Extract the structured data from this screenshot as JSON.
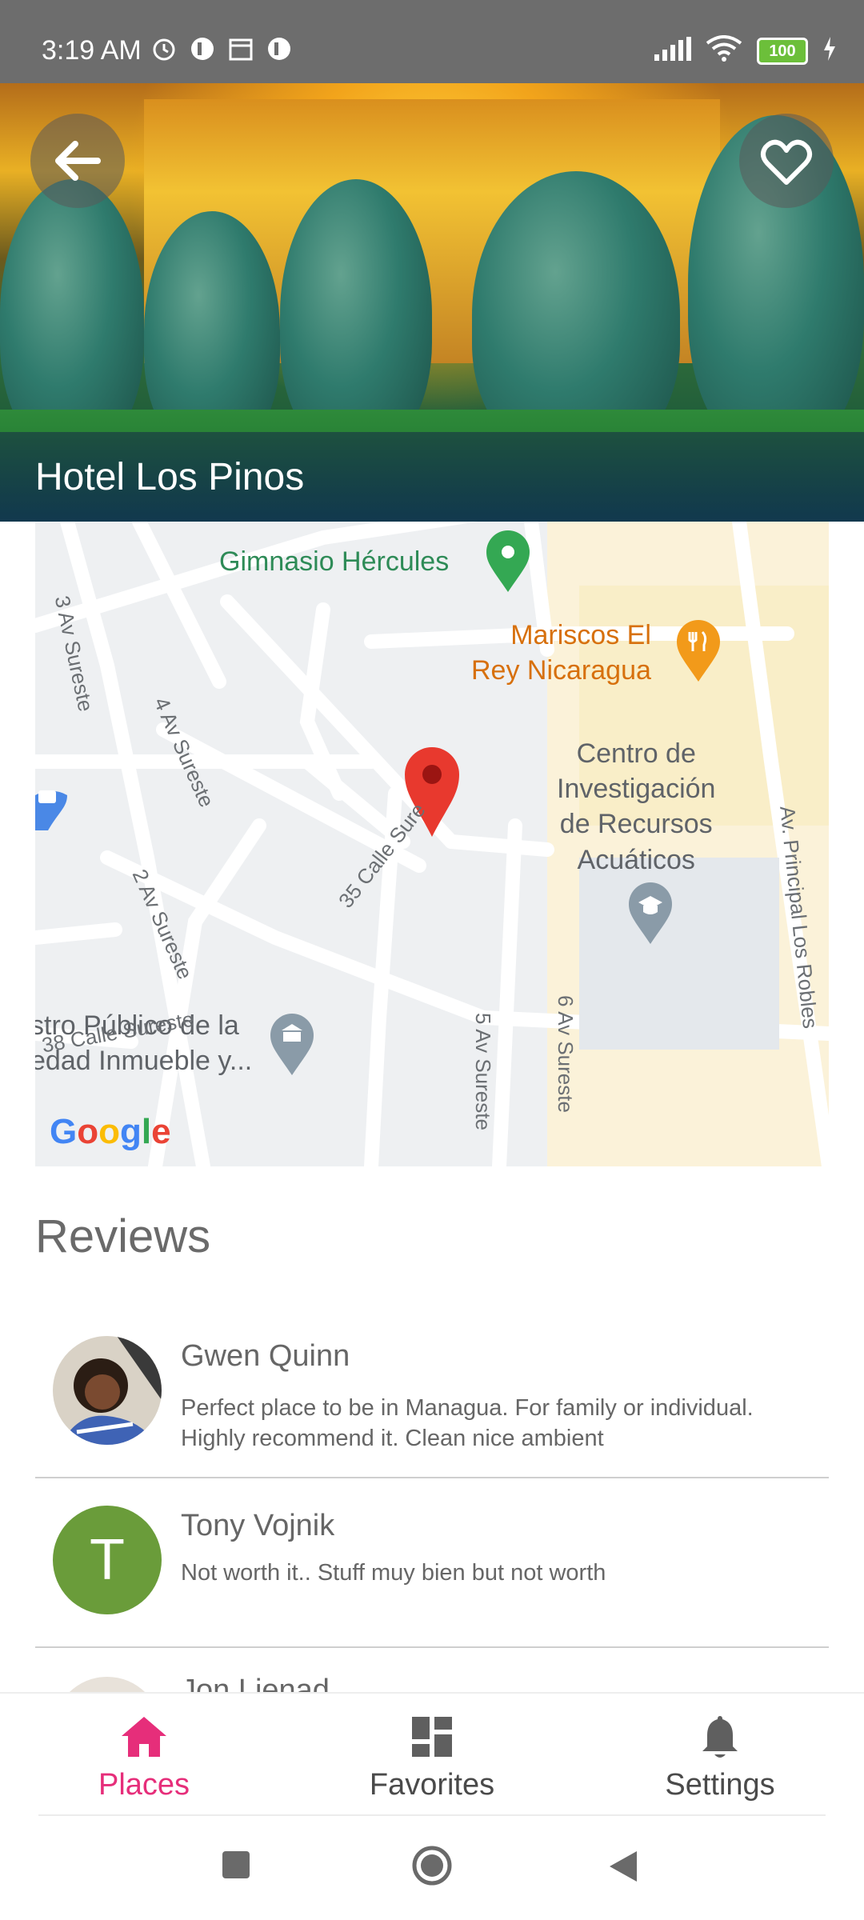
{
  "status_bar": {
    "time": "3:19 AM",
    "battery": "100"
  },
  "place": {
    "title": "Hotel Los Pinos"
  },
  "map": {
    "pois": [
      {
        "name": "Gimnasio Hércules"
      },
      {
        "name": "Mariscos El\nRey Nicaragua"
      },
      {
        "name": "Centro de\nInvestigación\nde Recursos\nAcuáticos"
      },
      {
        "name": "stro Público de la\nedad Inmueble y..."
      }
    ],
    "streets": [
      "3 Av Sureste",
      "4 Av Sureste",
      "35 Calle Sure",
      "2 Av Sureste",
      "38 Calle Sureste",
      "5 Av Sureste",
      "6 Av Sureste",
      "Av. Principal Los Robles"
    ],
    "attribution": "Google"
  },
  "reviews": {
    "title": "Reviews",
    "items": [
      {
        "name": "Gwen Quinn",
        "text": "Perfect place to be in Managua. For family  or individual. Highly recommend it. Clean nice ambient"
      },
      {
        "name": "Tony Vojnik",
        "initial": "T",
        "text": "Not worth it.. Stuff muy bien but not worth"
      },
      {
        "name": "Jon Lienad"
      }
    ]
  },
  "bottom_nav": {
    "items": [
      {
        "label": "Places",
        "icon": "home-icon",
        "active": true
      },
      {
        "label": "Favorites",
        "icon": "dashboard-icon"
      },
      {
        "label": "Settings",
        "icon": "bell-icon"
      }
    ]
  },
  "colors": {
    "accent": "#e62e7a",
    "avatar_green": "#6a9c3a",
    "status_bar": "#6d6d6d"
  }
}
